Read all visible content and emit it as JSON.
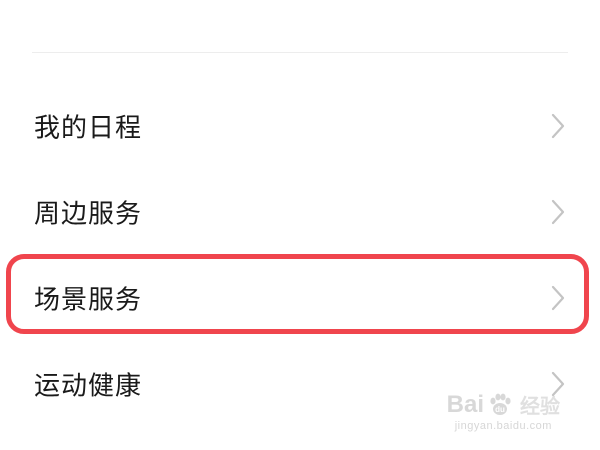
{
  "menu": {
    "items": [
      {
        "label": "我的日程"
      },
      {
        "label": "周边服务"
      },
      {
        "label": "场景服务"
      },
      {
        "label": "运动健康"
      }
    ],
    "chevron_icon": "chevron-right-icon"
  },
  "highlight": {
    "item_label": "场景服务",
    "color": "#f0454d"
  },
  "watermark": {
    "text_before_paw": "Bai",
    "text_after_paw": "",
    "experience": "经验",
    "url": "jingyan.baidu.com"
  }
}
